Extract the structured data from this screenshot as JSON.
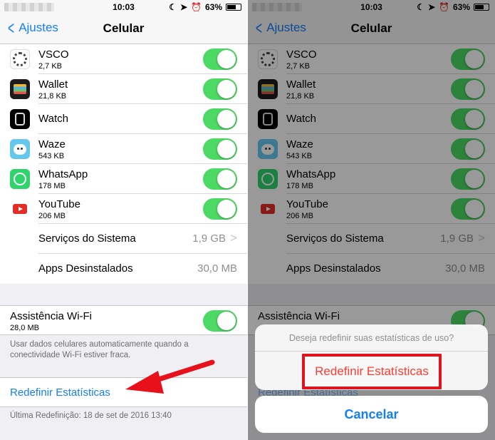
{
  "status": {
    "time": "10:03",
    "battery": "63%"
  },
  "nav": {
    "back_label": "Ajustes",
    "title": "Celular"
  },
  "apps": [
    {
      "name": "VSCO",
      "size": "2,7 KB",
      "icon": "vsco-icon"
    },
    {
      "name": "Wallet",
      "size": "21,8 KB",
      "icon": "wallet-icon"
    },
    {
      "name": "Watch",
      "size": "",
      "icon": "watch-icon"
    },
    {
      "name": "Waze",
      "size": "543 KB",
      "icon": "waze-icon"
    },
    {
      "name": "WhatsApp",
      "size": "178 MB",
      "icon": "whatsapp-icon"
    },
    {
      "name": "YouTube",
      "size": "206 MB",
      "icon": "youtube-icon"
    }
  ],
  "system": {
    "label": "Serviços do Sistema",
    "value": "1,9 GB"
  },
  "uninstalled": {
    "label": "Apps Desinstalados",
    "value": "30,0 MB"
  },
  "wifi_assist": {
    "label": "Assistência Wi-Fi",
    "size": "28,0 MB",
    "footer": "Usar dados celulares automaticamente quando a conectividade Wi-Fi estiver fraca."
  },
  "reset": {
    "label": "Redefinir Estatísticas",
    "last": "Última Redefinição: 18 de set de 2016 13:40"
  },
  "sheet": {
    "question": "Deseja redefinir suas estatísticas de uso?",
    "confirm": "Redefinir Estatísticas",
    "cancel": "Cancelar"
  },
  "colors": {
    "accent": "#157efb",
    "toggle_on": "#4cd964",
    "destructive": "#ff3b30",
    "highlight": "#e0141e"
  }
}
